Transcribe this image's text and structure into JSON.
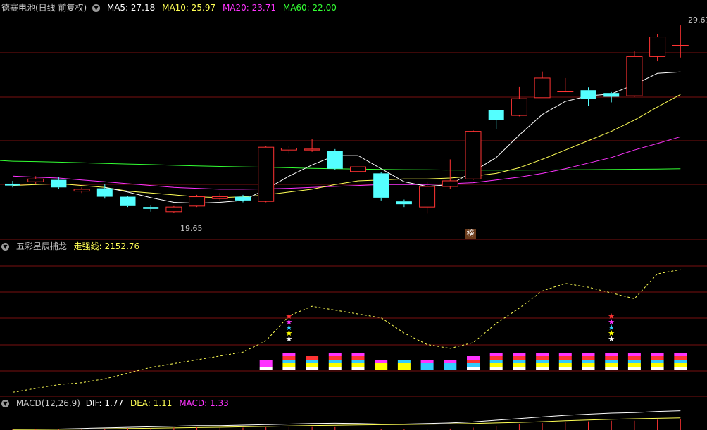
{
  "main_panel": {
    "title": "德赛电池(日线 前复权)",
    "ma_labels": [
      {
        "text": "MA5: 27.18",
        "color": "#ffffff"
      },
      {
        "text": "MA10: 25.97",
        "color": "#ffff55"
      },
      {
        "text": "MA20: 23.71",
        "color": "#ff33ff"
      },
      {
        "text": "MA60: 22.00",
        "color": "#33ff33"
      }
    ],
    "high_label": "29.67",
    "low_label": "19.65",
    "badge": "榜"
  },
  "indicator_panel": {
    "title": "五彩星辰捕龙",
    "line_label": "走强线: 2152.76",
    "line_color": "#ffff55"
  },
  "macd_panel": {
    "title": "MACD(12,26,9)",
    "values": [
      {
        "text": "DIF: 1.77",
        "color": "#ffffff"
      },
      {
        "text": "DEA: 1.11",
        "color": "#ffff55"
      },
      {
        "text": "MACD: 1.33",
        "color": "#ff33ff"
      }
    ]
  },
  "colors": {
    "up": "#ff3333",
    "down": "#54ffff",
    "grid": "#7a1010",
    "ma5": "#ffffff",
    "ma10": "#ffff55",
    "ma20": "#ff33ff",
    "ma60": "#33ff33"
  },
  "chart_data": {
    "type": "candlestick",
    "price_range": [
      18.6,
      30.2
    ],
    "candles": [
      {
        "o": 21.2,
        "h": 21.35,
        "l": 21.0,
        "c": 21.1
      },
      {
        "o": 21.3,
        "h": 21.6,
        "l": 21.2,
        "c": 21.45
      },
      {
        "o": 21.4,
        "h": 21.55,
        "l": 20.9,
        "c": 21.0
      },
      {
        "o": 20.8,
        "h": 21.0,
        "l": 20.7,
        "c": 20.9
      },
      {
        "o": 20.95,
        "h": 21.2,
        "l": 20.4,
        "c": 20.5
      },
      {
        "o": 20.5,
        "h": 20.55,
        "l": 19.95,
        "c": 20.0
      },
      {
        "o": 19.95,
        "h": 20.05,
        "l": 19.7,
        "c": 19.85
      },
      {
        "o": 19.7,
        "h": 20.0,
        "l": 19.65,
        "c": 19.95
      },
      {
        "o": 20.0,
        "h": 20.6,
        "l": 19.95,
        "c": 20.5
      },
      {
        "o": 20.4,
        "h": 20.7,
        "l": 20.3,
        "c": 20.5
      },
      {
        "o": 20.5,
        "h": 20.6,
        "l": 20.2,
        "c": 20.3
      },
      {
        "o": 20.25,
        "h": 23.2,
        "l": 20.2,
        "c": 23.15
      },
      {
        "o": 23.0,
        "h": 23.2,
        "l": 22.8,
        "c": 23.1
      },
      {
        "o": 23.0,
        "h": 23.6,
        "l": 22.9,
        "c": 23.05
      },
      {
        "o": 22.95,
        "h": 23.05,
        "l": 21.95,
        "c": 22.0
      },
      {
        "o": 21.85,
        "h": 22.1,
        "l": 21.55,
        "c": 22.1
      },
      {
        "o": 21.75,
        "h": 21.8,
        "l": 20.3,
        "c": 20.45
      },
      {
        "o": 20.25,
        "h": 20.35,
        "l": 19.95,
        "c": 20.1
      },
      {
        "o": 19.95,
        "h": 21.3,
        "l": 19.6,
        "c": 21.05
      },
      {
        "o": 21.05,
        "h": 22.5,
        "l": 20.9,
        "c": 21.35
      },
      {
        "o": 21.45,
        "h": 24.05,
        "l": 21.4,
        "c": 24.0
      },
      {
        "o": 25.15,
        "h": 25.15,
        "l": 24.1,
        "c": 24.6
      },
      {
        "o": 24.85,
        "h": 26.4,
        "l": 24.8,
        "c": 25.75
      },
      {
        "o": 25.8,
        "h": 27.2,
        "l": 25.8,
        "c": 26.85
      },
      {
        "o": 26.15,
        "h": 26.85,
        "l": 26.1,
        "c": 26.15
      },
      {
        "o": 26.2,
        "h": 26.35,
        "l": 25.35,
        "c": 25.75
      },
      {
        "o": 26.05,
        "h": 26.1,
        "l": 25.55,
        "c": 25.85
      },
      {
        "o": 25.9,
        "h": 28.3,
        "l": 25.85,
        "c": 28.0
      },
      {
        "o": 28.0,
        "h": 29.2,
        "l": 27.75,
        "c": 29.05
      },
      {
        "o": 28.6,
        "h": 29.67,
        "l": 27.95,
        "c": 28.6
      }
    ],
    "ma5": [
      null,
      null,
      null,
      null,
      21.0,
      20.75,
      20.45,
      20.2,
      20.15,
      20.2,
      20.3,
      20.9,
      21.6,
      22.2,
      22.7,
      22.7,
      22.0,
      21.3,
      21.05,
      21.15,
      21.85,
      22.6,
      23.8,
      24.9,
      25.6,
      25.9,
      26.0,
      26.5,
      27.1,
      27.18
    ],
    "ma10": [
      21.1,
      21.15,
      21.2,
      21.1,
      21.0,
      20.8,
      20.7,
      20.6,
      20.5,
      20.45,
      20.5,
      20.6,
      20.75,
      20.9,
      21.15,
      21.35,
      21.4,
      21.45,
      21.45,
      21.5,
      21.6,
      21.75,
      22.05,
      22.5,
      23.0,
      23.5,
      24.0,
      24.6,
      25.3,
      25.97
    ],
    "ma20": [
      21.6,
      21.55,
      21.5,
      21.4,
      21.3,
      21.2,
      21.1,
      21.0,
      20.95,
      20.9,
      20.9,
      20.92,
      20.95,
      21.0,
      21.05,
      21.1,
      21.15,
      21.15,
      21.15,
      21.2,
      21.25,
      21.4,
      21.55,
      21.75,
      22.0,
      22.3,
      22.6,
      23.0,
      23.35,
      23.71
    ],
    "ma60": [
      22.4,
      22.38,
      22.35,
      22.32,
      22.28,
      22.25,
      22.22,
      22.18,
      22.15,
      22.12,
      22.1,
      22.08,
      22.05,
      22.02,
      22.0,
      21.98,
      21.96,
      21.95,
      21.94,
      21.93,
      21.92,
      21.92,
      21.92,
      21.93,
      21.94,
      21.95,
      21.96,
      21.97,
      21.98,
      22.0
    ]
  },
  "indicator_data": {
    "line_range": [
      1500,
      2230
    ],
    "line": [
      1510,
      1530,
      1550,
      1560,
      1580,
      1610,
      1640,
      1660,
      1680,
      1700,
      1720,
      1780,
      1910,
      1960,
      1940,
      1920,
      1900,
      1820,
      1760,
      1740,
      1770,
      1870,
      1950,
      2040,
      2080,
      2060,
      2030,
      2000,
      2130,
      2152.76
    ],
    "bars": [
      {
        "i": 11,
        "colors": [
          "#ffffff",
          "#ff33ff",
          "#ff33ff"
        ]
      },
      {
        "i": 12,
        "colors": [
          "#ffffff",
          "#ffff00",
          "#33ccff",
          "#ff3333",
          "#ff33ff"
        ]
      },
      {
        "i": 13,
        "colors": [
          "#ffffff",
          "#ffff00",
          "#33ccff",
          "#ff3333"
        ]
      },
      {
        "i": 14,
        "colors": [
          "#ffffff",
          "#ffff00",
          "#33ccff",
          "#ff3333",
          "#ff33ff"
        ]
      },
      {
        "i": 15,
        "colors": [
          "#ffffff",
          "#ffff00",
          "#33ccff",
          "#ff3333",
          "#ff33ff"
        ]
      },
      {
        "i": 16,
        "colors": [
          "#ffff00",
          "#ffff00",
          "#ff33ff"
        ]
      },
      {
        "i": 17,
        "colors": [
          "#ffff00",
          "#ffff00",
          "#33ccff"
        ]
      },
      {
        "i": 18,
        "colors": [
          "#33ccff",
          "#33ccff",
          "#ff33ff"
        ]
      },
      {
        "i": 19,
        "colors": [
          "#33ccff",
          "#33ccff",
          "#ff33ff"
        ]
      },
      {
        "i": 20,
        "colors": [
          "#ffffff",
          "#33ccff",
          "#ff3333",
          "#ff33ff"
        ]
      },
      {
        "i": 21,
        "colors": [
          "#ffffff",
          "#ffff00",
          "#33ccff",
          "#ff3333",
          "#ff33ff"
        ]
      },
      {
        "i": 22,
        "colors": [
          "#ffffff",
          "#ffff00",
          "#33ccff",
          "#ff3333",
          "#ff33ff"
        ]
      },
      {
        "i": 23,
        "colors": [
          "#ffffff",
          "#ffff00",
          "#33ccff",
          "#ff3333",
          "#ff33ff"
        ]
      },
      {
        "i": 24,
        "colors": [
          "#ffffff",
          "#ffff00",
          "#33ccff",
          "#ff3333",
          "#ff33ff"
        ]
      },
      {
        "i": 25,
        "colors": [
          "#ffffff",
          "#ffff00",
          "#33ccff",
          "#ff3333",
          "#ff33ff"
        ]
      },
      {
        "i": 26,
        "colors": [
          "#ffffff",
          "#ffff00",
          "#33ccff",
          "#ff3333",
          "#ff33ff"
        ]
      },
      {
        "i": 27,
        "colors": [
          "#ffffff",
          "#ffff00",
          "#33ccff",
          "#ff3333",
          "#ff33ff"
        ]
      },
      {
        "i": 28,
        "colors": [
          "#ffffff",
          "#ffff00",
          "#33ccff",
          "#ff3333",
          "#ff33ff"
        ]
      },
      {
        "i": 29,
        "colors": [
          "#ffffff",
          "#ffff00",
          "#33ccff",
          "#ff3333",
          "#ff33ff"
        ]
      }
    ],
    "stars": [
      {
        "i": 12,
        "colors": [
          "#ffffff",
          "#ffff00",
          "#33ccff",
          "#ff33ff",
          "#ff3333"
        ]
      },
      {
        "i": 26,
        "colors": [
          "#ffffff",
          "#ffff00",
          "#33ccff",
          "#ff33ff",
          "#ff3333"
        ]
      }
    ]
  },
  "macd_data": {
    "dif": [
      0.1,
      0.1,
      0.1,
      0.15,
      0.2,
      0.25,
      0.3,
      0.35,
      0.4,
      0.4,
      0.45,
      0.5,
      0.55,
      0.6,
      0.62,
      0.6,
      0.55,
      0.55,
      0.6,
      0.65,
      0.75,
      0.9,
      1.05,
      1.2,
      1.35,
      1.45,
      1.55,
      1.6,
      1.7,
      1.77
    ],
    "dea": [
      0.05,
      0.06,
      0.07,
      0.09,
      0.11,
      0.14,
      0.17,
      0.2,
      0.23,
      0.26,
      0.3,
      0.33,
      0.37,
      0.41,
      0.44,
      0.47,
      0.49,
      0.51,
      0.53,
      0.56,
      0.6,
      0.65,
      0.7,
      0.77,
      0.85,
      0.92,
      0.98,
      1.03,
      1.07,
      1.11
    ],
    "range": [
      0,
      2.0
    ]
  }
}
